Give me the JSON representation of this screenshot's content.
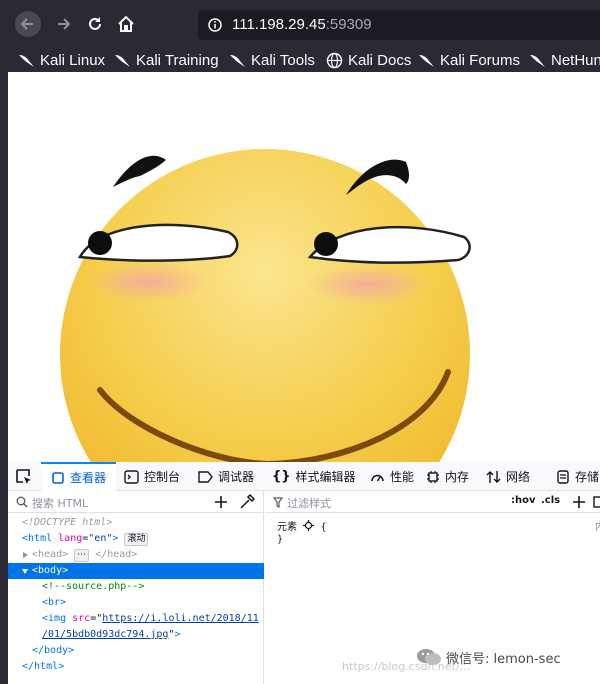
{
  "nav": {
    "url_host": "111.198.29.45",
    "url_port": ":59309"
  },
  "bookmarks": [
    {
      "label": "Kali Linux",
      "icon": "kali-dragon-icon"
    },
    {
      "label": "Kali Training",
      "icon": "kali-dragon-icon"
    },
    {
      "label": "Kali Tools",
      "icon": "kali-dragon-icon"
    },
    {
      "label": "Kali Docs",
      "icon": "globe-icon"
    },
    {
      "label": "Kali Forums",
      "icon": "kali-dragon-icon"
    },
    {
      "label": "NetHun",
      "icon": "kali-dragon-icon"
    }
  ],
  "devtools": {
    "tabs": [
      {
        "label": "查看器",
        "icon": "inspector-icon",
        "active": true
      },
      {
        "label": "控制台",
        "icon": "console-icon"
      },
      {
        "label": "调试器",
        "icon": "debugger-icon"
      },
      {
        "label": "样式编辑器",
        "icon": "style-editor-icon"
      },
      {
        "label": "性能",
        "icon": "performance-icon"
      },
      {
        "label": "内存",
        "icon": "memory-icon"
      },
      {
        "label": "网络",
        "icon": "network-icon"
      },
      {
        "label": "存储",
        "icon": "storage-icon"
      }
    ],
    "markup_search_placeholder": "搜索 HTML",
    "tree": {
      "doctype": "<!DOCTYPE html>",
      "html_open_tag": "html",
      "html_lang_attr": "lang",
      "html_lang_val": "\"en\"",
      "scroll_badge": "滚动",
      "head_open": "<head>",
      "head_ellipsis": "⋯",
      "head_close": "</head>",
      "body_open": "<body>",
      "comment": "<!--source.php-->",
      "br": "<br>",
      "img_tag": "img",
      "img_src_attr": "src",
      "img_src_val_1": "https://i.loli.net/2018/11",
      "img_src_val_2": "/01/5bdb0d93dc794.jpg",
      "body_close": "</body>",
      "html_close": "</html>"
    },
    "rules": {
      "filter_placeholder": "过滤样式",
      "hov_label": ":hov",
      "cls_label": ".cls",
      "element_label": "元素",
      "open_brace": "{",
      "close_brace": "}",
      "source_label": "内"
    }
  },
  "watermark": {
    "wechat": "微信号: lemon-sec",
    "blog": "https://blog.csdn.net/..."
  }
}
